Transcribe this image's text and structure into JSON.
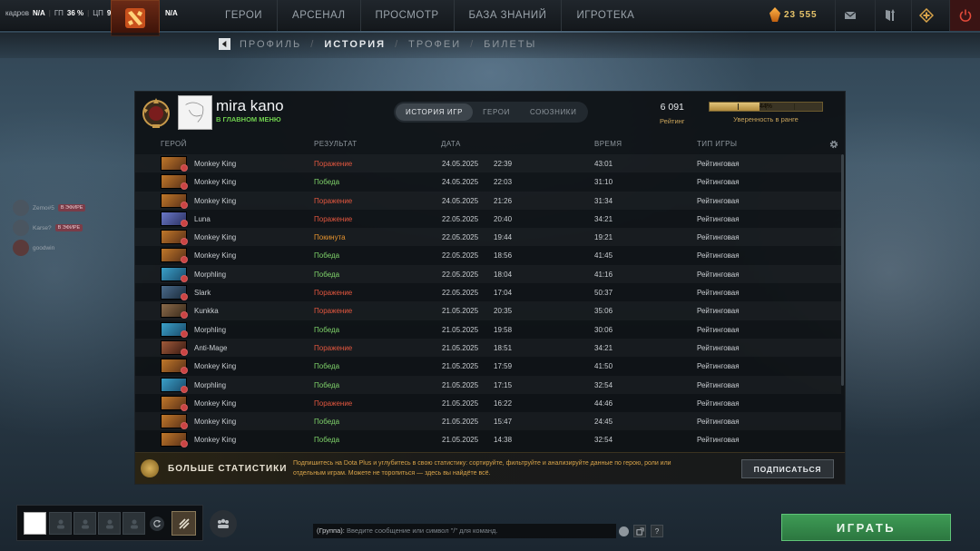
{
  "topbar": {
    "stats": [
      {
        "label": "кадров",
        "value": "N/A"
      },
      {
        "label": "ГП",
        "value": "36 %"
      },
      {
        "label": "ЦП",
        "value": "9 %"
      },
      {
        "label": "",
        "value": "N/A"
      }
    ],
    "nav": [
      "ГЕРОИ",
      "АРСЕНАЛ",
      "ПРОСМОТР",
      "БАЗА ЗНАНИЙ",
      "ИГРОТЕКА"
    ],
    "shards": "23 555",
    "accent": "#e6c36a"
  },
  "subnav": {
    "items": [
      "ПРОФИЛЬ",
      "ИСТОРИЯ",
      "ТРОФЕИ",
      "БИЛЕТЫ"
    ],
    "active": "ИСТОРИЯ"
  },
  "friends": [
    {
      "name": "Zemo#5",
      "badge": "В ЭФИРЕ"
    },
    {
      "name": "Karse?",
      "badge": "В ЭФИРЕ"
    },
    {
      "name": "goodwin",
      "badge": ""
    }
  ],
  "profile": {
    "name": "mira kano",
    "status": "В ГЛАВНОМ МЕНЮ",
    "tabs": [
      "ИСТОРИЯ ИГР",
      "ГЕРОИ",
      "СОЮЗНИКИ"
    ],
    "rating_value": "6 091",
    "rating_label": "Рейтинг",
    "confidence_value": "44%",
    "confidence_fraction": 0.44,
    "confidence_label": "Уверенность в ранге"
  },
  "table": {
    "headers": [
      "ГЕРОЙ",
      "РЕЗУЛЬТАТ",
      "ДАТА",
      "ВРЕМЯ",
      "ТИП ИГРЫ"
    ],
    "rows": [
      {
        "hero": "Monkey King",
        "result": "Поражение",
        "date": "24.05.2025",
        "time": "22:39",
        "duration": "43:01",
        "type": "Рейтинговая"
      },
      {
        "hero": "Monkey King",
        "result": "Победа",
        "date": "24.05.2025",
        "time": "22:03",
        "duration": "31:10",
        "type": "Рейтинговая"
      },
      {
        "hero": "Monkey King",
        "result": "Поражение",
        "date": "24.05.2025",
        "time": "21:26",
        "duration": "31:34",
        "type": "Рейтинговая"
      },
      {
        "hero": "Luna",
        "result": "Поражение",
        "date": "22.05.2025",
        "time": "20:40",
        "duration": "34:21",
        "type": "Рейтинговая"
      },
      {
        "hero": "Monkey King",
        "result": "Покинута",
        "date": "22.05.2025",
        "time": "19:44",
        "duration": "19:21",
        "type": "Рейтинговая"
      },
      {
        "hero": "Monkey King",
        "result": "Победа",
        "date": "22.05.2025",
        "time": "18:56",
        "duration": "41:45",
        "type": "Рейтинговая"
      },
      {
        "hero": "Morphling",
        "result": "Победа",
        "date": "22.05.2025",
        "time": "18:04",
        "duration": "41:16",
        "type": "Рейтинговая"
      },
      {
        "hero": "Slark",
        "result": "Поражение",
        "date": "22.05.2025",
        "time": "17:04",
        "duration": "50:37",
        "type": "Рейтинговая"
      },
      {
        "hero": "Kunkka",
        "result": "Поражение",
        "date": "21.05.2025",
        "time": "20:35",
        "duration": "35:06",
        "type": "Рейтинговая"
      },
      {
        "hero": "Morphling",
        "result": "Победа",
        "date": "21.05.2025",
        "time": "19:58",
        "duration": "30:06",
        "type": "Рейтинговая"
      },
      {
        "hero": "Anti-Mage",
        "result": "Поражение",
        "date": "21.05.2025",
        "time": "18:51",
        "duration": "34:21",
        "type": "Рейтинговая"
      },
      {
        "hero": "Monkey King",
        "result": "Победа",
        "date": "21.05.2025",
        "time": "17:59",
        "duration": "41:50",
        "type": "Рейтинговая"
      },
      {
        "hero": "Morphling",
        "result": "Победа",
        "date": "21.05.2025",
        "time": "17:15",
        "duration": "32:54",
        "type": "Рейтинговая"
      },
      {
        "hero": "Monkey King",
        "result": "Поражение",
        "date": "21.05.2025",
        "time": "16:22",
        "duration": "44:46",
        "type": "Рейтинговая"
      },
      {
        "hero": "Monkey King",
        "result": "Победа",
        "date": "21.05.2025",
        "time": "15:47",
        "duration": "24:45",
        "type": "Рейтинговая"
      },
      {
        "hero": "Monkey King",
        "result": "Победа",
        "date": "21.05.2025",
        "time": "14:38",
        "duration": "32:54",
        "type": "Рейтинговая"
      }
    ]
  },
  "dota_plus": {
    "title": "БОЛЬШЕ СТАТИСТИКИ",
    "text": "Подпишитесь на Dota Plus и углубитесь в свою статистику: сортируйте, фильтруйте и анализируйте данные по герою, роли или отдельным играм. Можете не торопиться — здесь вы найдёте всё.",
    "button": "ПОДПИСАТЬСЯ"
  },
  "chat": {
    "group": "(Группа):",
    "placeholder": "Введите сообщение или символ \"/\" для команд."
  },
  "play_button": "ИГРАТЬ",
  "colors": {
    "win": "#7fd36a",
    "loss": "#e3573f",
    "abandon": "#e6932e",
    "play": "#3e9b55"
  }
}
